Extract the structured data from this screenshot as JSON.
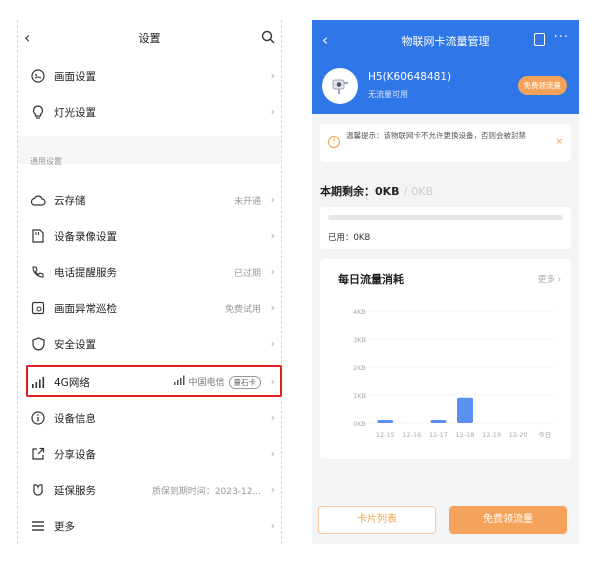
{
  "left": {
    "title": "设置",
    "rows": [
      {
        "label": "画面设置",
        "value": ""
      },
      {
        "label": "灯光设置",
        "value": ""
      },
      {
        "label": "云存储",
        "value": "未开通"
      },
      {
        "label": "设备录像设置",
        "value": ""
      },
      {
        "label": "电话提醒服务",
        "value": "已过期"
      },
      {
        "label": "画面异常巡检",
        "value": "免费试用"
      },
      {
        "label": "安全设置",
        "value": ""
      },
      {
        "label": "4G网络",
        "value": "中国电信",
        "badge": "量石卡"
      },
      {
        "label": "设备信息",
        "value": ""
      },
      {
        "label": "分享设备",
        "value": ""
      },
      {
        "label": "延保服务",
        "value": "质保到期时间：2023-12..."
      },
      {
        "label": "更多",
        "value": ""
      }
    ],
    "section_label": "通用设置"
  },
  "right": {
    "title": "物联网卡流量管理",
    "device_name": "H5(K60648481)",
    "device_status": "无流量可用",
    "free_button": "免费领流量",
    "notice": "温馨提示：该物联网卡不允许更换设备，否则会被封禁",
    "remain_label": "本期剩余：",
    "remain_value": "0KB",
    "remain_total": "0KB",
    "used_label": "已用：0KB",
    "used_fraction": 0,
    "chart_more": "更多",
    "card_list_button": "卡片列表",
    "free_flow_button": "免费领流量"
  },
  "chart_data": {
    "type": "bar",
    "title": "每日流量消耗",
    "categories": [
      "12-15",
      "12-16",
      "12-17",
      "12-18",
      "12-19",
      "12-20",
      "今日"
    ],
    "values": [
      0.1,
      0,
      0.05,
      0.9,
      0,
      0,
      0
    ],
    "yticks": [
      "0KB",
      "1KB",
      "2KB",
      "3KB",
      "4KB"
    ],
    "ylim": [
      0,
      4
    ],
    "color": "#5b8ff0"
  }
}
